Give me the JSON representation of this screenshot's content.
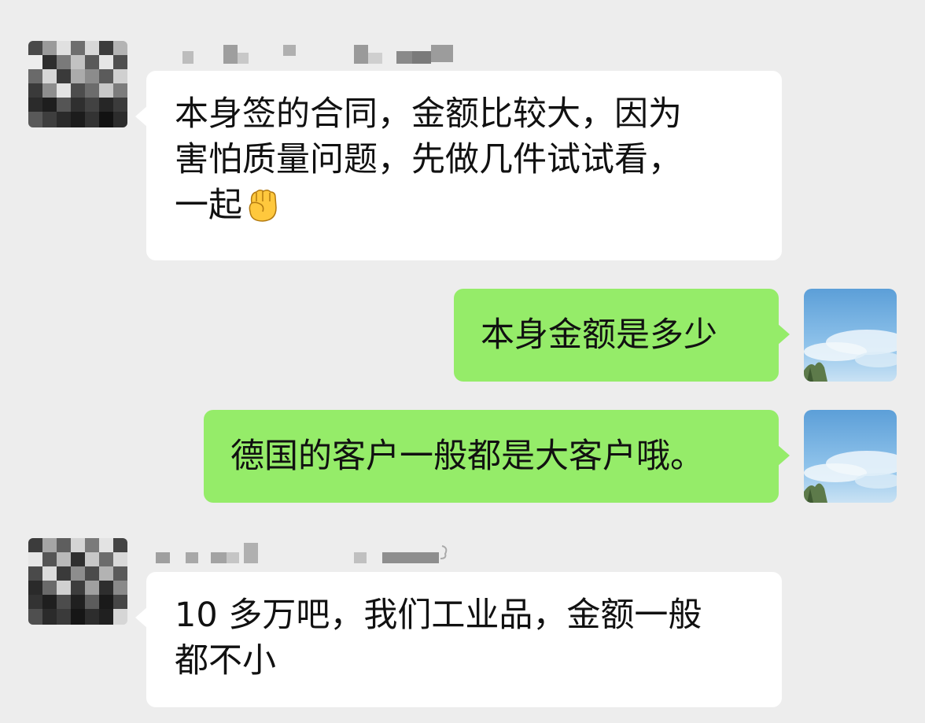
{
  "messages": [
    {
      "direction": "incoming",
      "lines": [
        "本身签的合同，金额比较大，因为",
        "害怕质量问题，先做几件试试看，",
        "一起"
      ],
      "emoji": "raised-fist-emoji"
    },
    {
      "direction": "outgoing",
      "text": "本身金额是多少"
    },
    {
      "direction": "outgoing",
      "text": "德国的客户一般都是大客户哦。"
    },
    {
      "direction": "incoming",
      "lines": [
        "10 多万吧，我们工业品，金额一般",
        "都不小"
      ]
    }
  ],
  "colors": {
    "background": "#ededed",
    "incoming_bubble": "#ffffff",
    "outgoing_bubble": "#95ec69",
    "text": "#111111"
  }
}
